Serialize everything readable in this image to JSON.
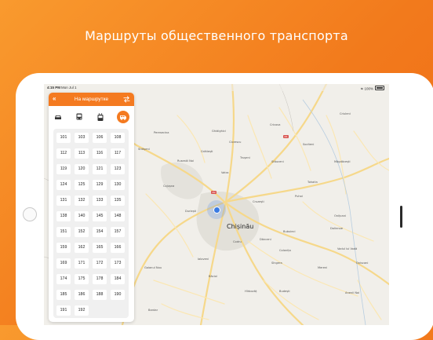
{
  "headline": "Маршруты общественного транспорта",
  "status_bar": {
    "time": "4:15 PM",
    "date": "Mon Jul 1",
    "battery": "100%"
  },
  "panel": {
    "title": "На маршрутке",
    "back_icon": "double-chevron-left-icon",
    "swap_icon": "swap-icon",
    "modes": [
      {
        "name": "car",
        "icon": "car-icon",
        "active": false
      },
      {
        "name": "bus",
        "icon": "bus-icon",
        "active": false
      },
      {
        "name": "trolleybus",
        "icon": "trolleybus-icon",
        "active": false
      },
      {
        "name": "minibus",
        "icon": "minibus-icon",
        "active": true
      }
    ],
    "routes": [
      "101",
      "103",
      "106",
      "108",
      "112",
      "113",
      "116",
      "117",
      "119",
      "120",
      "121",
      "123",
      "124",
      "125",
      "129",
      "130",
      "131",
      "132",
      "133",
      "135",
      "138",
      "140",
      "145",
      "148",
      "151",
      "152",
      "154",
      "157",
      "159",
      "162",
      "165",
      "166",
      "169",
      "171",
      "172",
      "173",
      "174",
      "175",
      "178",
      "184",
      "185",
      "186",
      "188",
      "190",
      "191",
      "192"
    ]
  },
  "map": {
    "cities_major": [
      "Chișinău"
    ],
    "cities": [
      "Strășeni",
      "Ialoveni",
      "Criuleni",
      "Cojușna",
      "Durlești",
      "Băcioi",
      "Sîngera",
      "Codru",
      "Dănceni",
      "Vatra",
      "Trușeni",
      "Stăuceni",
      "Grătiești",
      "Budești",
      "Bubuieci",
      "Măgdăcești",
      "Cricova",
      "Goianul Nou",
      "Bardar",
      "Anenii Noi",
      "Ghidighici",
      "Cruzești",
      "Ciorescu",
      "Peresecina",
      "Vadul lui Vodă",
      "Sociteni",
      "Rusestii Noi",
      "Puhoi",
      "Tohatin",
      "Colonița",
      "Mereni",
      "Hîrbovăț",
      "Onițcani",
      "Dolinnoe",
      "Oniscani"
    ],
    "road_badges": [
      "M2",
      "M1"
    ],
    "accent_color": "#f47a20",
    "location_color": "#3a7be3"
  }
}
